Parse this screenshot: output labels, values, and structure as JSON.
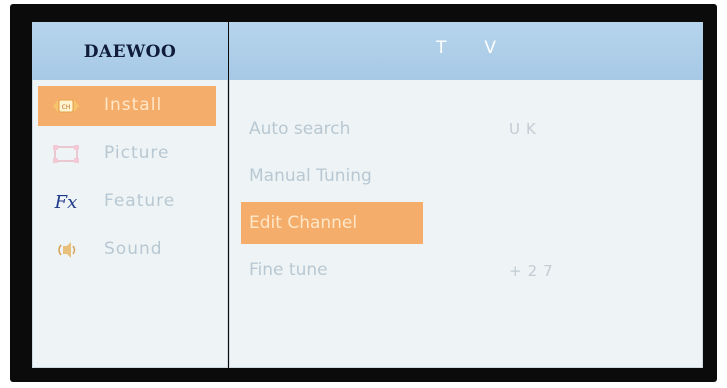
{
  "brand": "DAEWOO",
  "section_title": "TV",
  "menu": [
    {
      "label": "Install",
      "icon": "install-icon",
      "selected": true
    },
    {
      "label": "Picture",
      "icon": "picture-icon",
      "selected": false
    },
    {
      "label": "Feature",
      "icon": "feature-icon",
      "selected": false
    },
    {
      "label": "Sound",
      "icon": "sound-icon",
      "selected": false
    }
  ],
  "options": [
    {
      "label": "Auto search",
      "value": "UK"
    },
    {
      "label": "Manual Tuning",
      "value": ""
    },
    {
      "label": "Edit Channel",
      "value": "",
      "selected": true
    },
    {
      "label": "Fine tune",
      "value": "+27"
    }
  ],
  "icons": {
    "install": "CH",
    "feature": "Fx"
  },
  "colors": {
    "selection": "#f4ad6b",
    "header": "#a7c9e6",
    "panel": "#eef3f5",
    "background": "#0b0b0b"
  }
}
